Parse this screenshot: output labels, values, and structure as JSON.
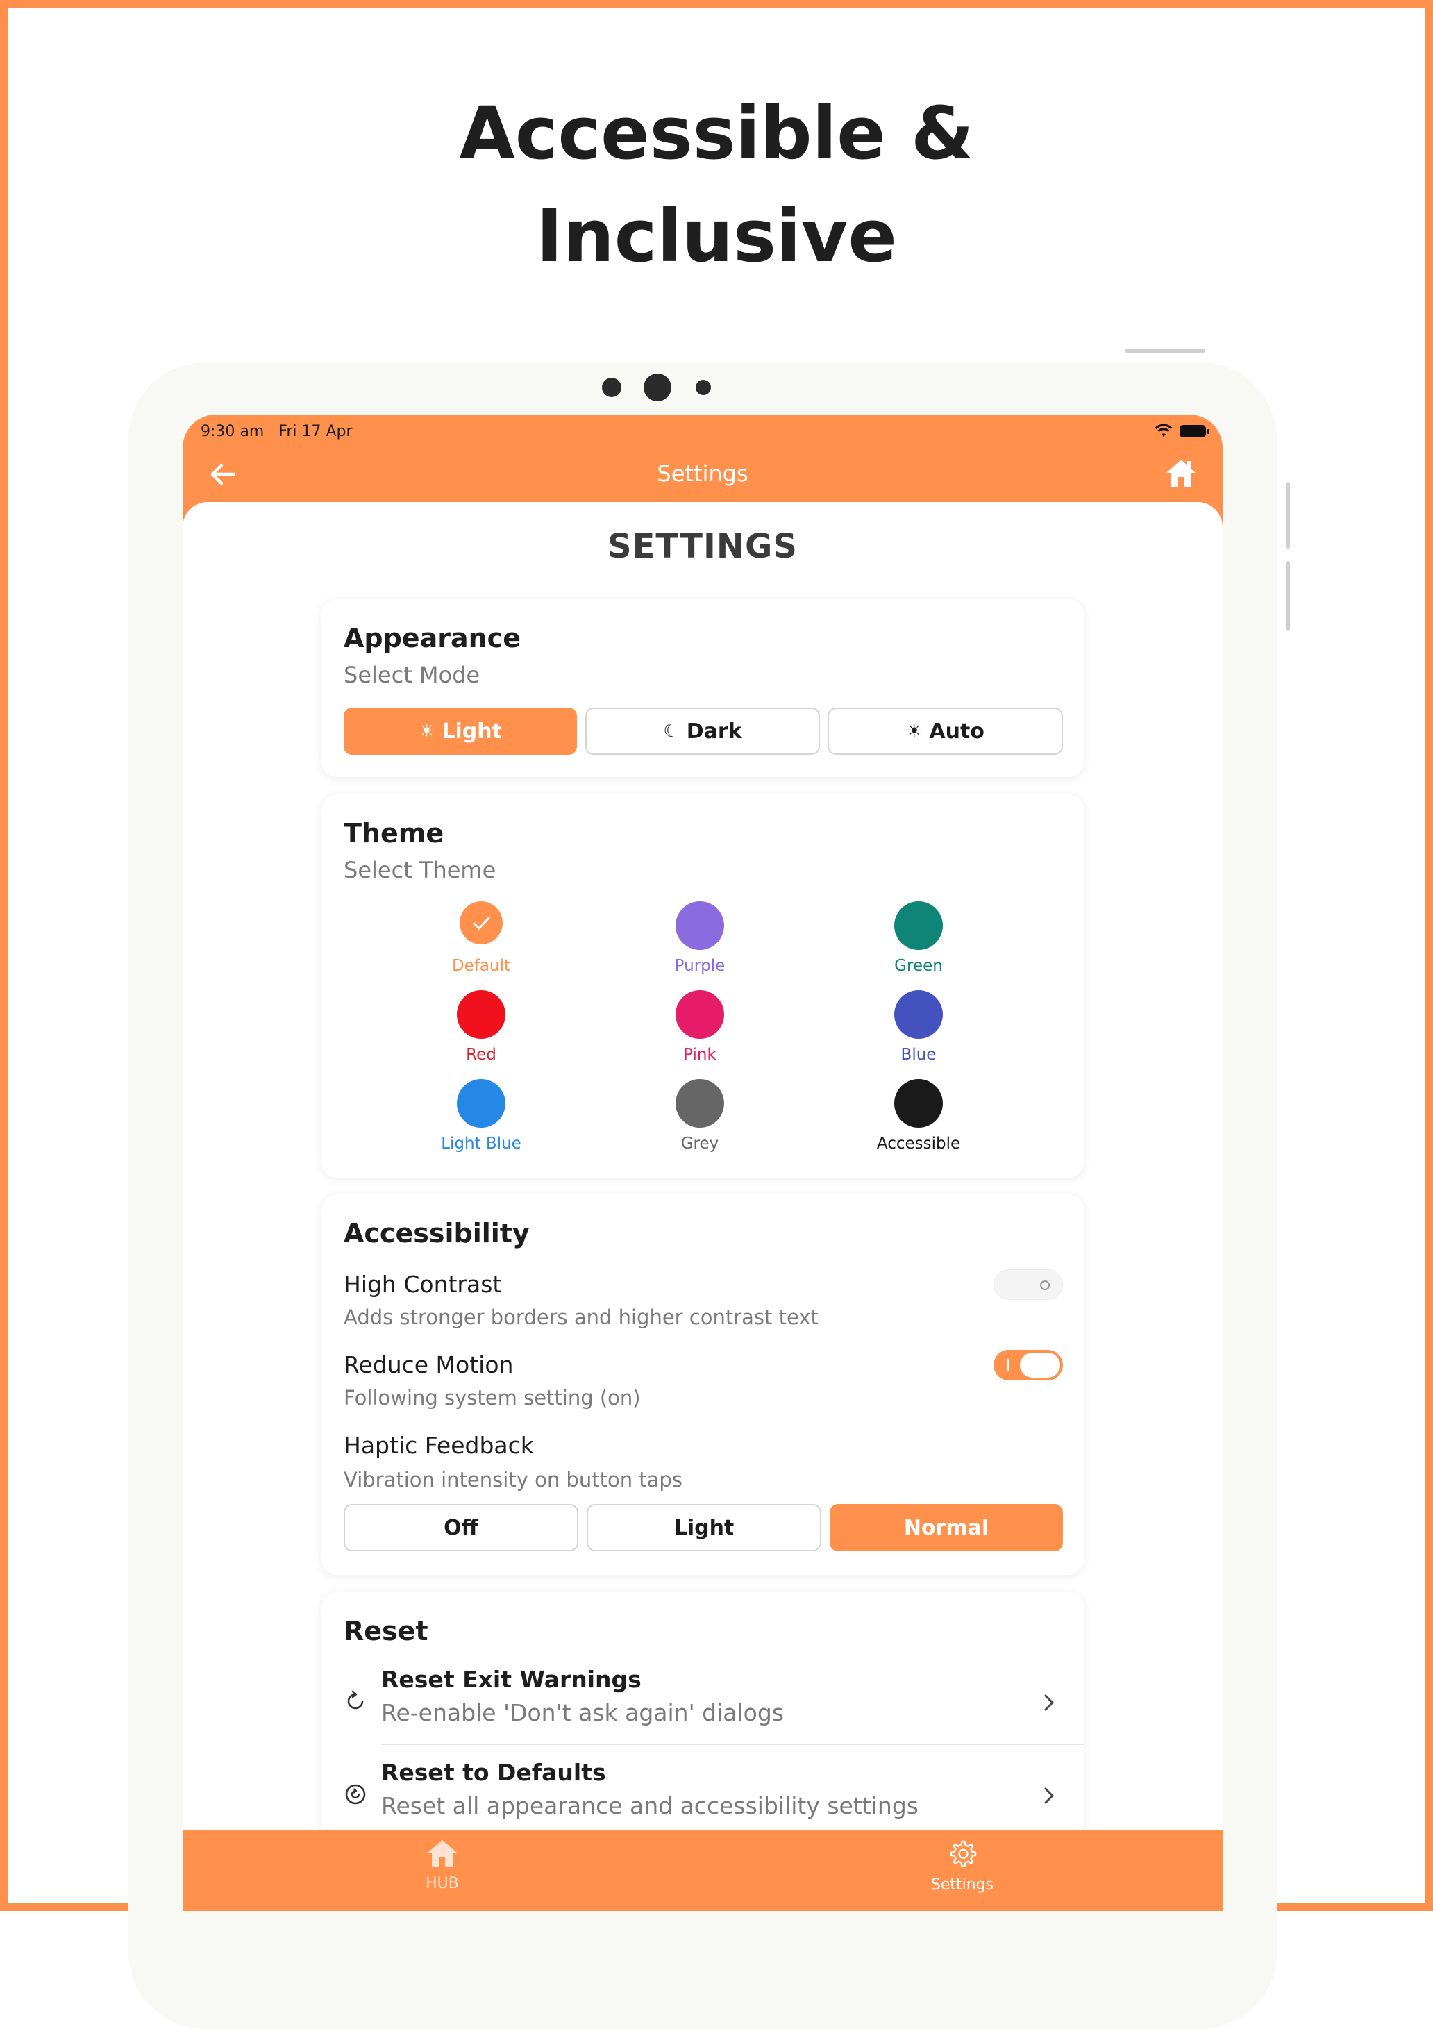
{
  "headline": {
    "line1": "Accessible &",
    "line2": "Inclusive"
  },
  "status_bar": {
    "time": "9:30 am",
    "date": "Fri 17 Apr"
  },
  "navbar": {
    "title": "Settings",
    "back_icon": "arrow-left-icon",
    "home_icon": "home-icon"
  },
  "page_title": "SETTINGS",
  "appearance": {
    "title": "Appearance",
    "subtitle": "Select Mode",
    "modes": [
      {
        "label": "Light",
        "icon": "☀",
        "active": true
      },
      {
        "label": "Dark",
        "icon": "☾",
        "active": false
      },
      {
        "label": "Auto",
        "icon": "☀",
        "active": false
      }
    ]
  },
  "theme": {
    "title": "Theme",
    "subtitle": "Select Theme",
    "swatches": [
      {
        "label": "Default",
        "color": "#FF914D",
        "label_color": "#FF914D",
        "selected": true
      },
      {
        "label": "Purple",
        "color": "#8A6BE0",
        "label_color": "#8A6BE0"
      },
      {
        "label": "Green",
        "color": "#0E8577",
        "label_color": "#0E8577"
      },
      {
        "label": "Red",
        "color": "#F0101E",
        "label_color": "#D81E2B"
      },
      {
        "label": "Pink",
        "color": "#E61C68",
        "label_color": "#E61C68"
      },
      {
        "label": "Blue",
        "color": "#4352BE",
        "label_color": "#4352BE"
      },
      {
        "label": "Light Blue",
        "color": "#2587E6",
        "label_color": "#2587E6"
      },
      {
        "label": "Grey",
        "color": "#666666",
        "label_color": "#666666"
      },
      {
        "label": "Accessible",
        "color": "#1A1A1A",
        "label_color": "#1A1A1A"
      }
    ]
  },
  "accessibility": {
    "title": "Accessibility",
    "high_contrast": {
      "title": "High Contrast",
      "desc": "Adds stronger borders and higher contrast text",
      "on": false
    },
    "reduce_motion": {
      "title": "Reduce Motion",
      "desc": "Following system setting (on)",
      "on": true
    },
    "haptic": {
      "title": "Haptic Feedback",
      "desc": "Vibration intensity on button taps",
      "options": [
        {
          "label": "Off",
          "active": false
        },
        {
          "label": "Light",
          "active": false
        },
        {
          "label": "Normal",
          "active": true
        }
      ]
    }
  },
  "reset": {
    "title": "Reset",
    "items": [
      {
        "title": "Reset Exit Warnings",
        "desc": "Re-enable 'Don't ask again' dialogs",
        "icon": "refresh-icon"
      },
      {
        "title": "Reset to Defaults",
        "desc": "Reset all appearance and accessibility settings",
        "icon": "restore-icon"
      }
    ]
  },
  "tabbar": {
    "items": [
      {
        "label": "HUB",
        "icon": "home-icon",
        "active": false
      },
      {
        "label": "Settings",
        "icon": "gear-icon",
        "active": true
      }
    ]
  },
  "colors": {
    "accent": "#FF914D"
  }
}
